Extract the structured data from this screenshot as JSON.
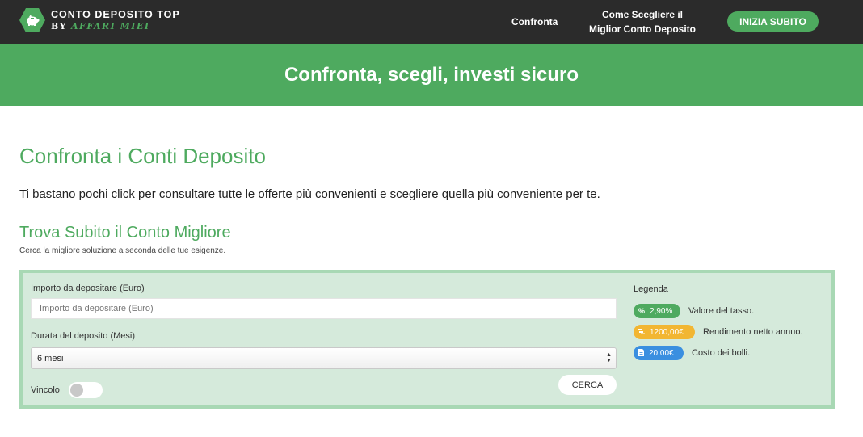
{
  "header": {
    "logo_title": "CONTO DEPOSITO TOP",
    "logo_by": "BY",
    "logo_brand": "AFFARI MIEI",
    "nav": {
      "confronta": "Confronta",
      "come_line1": "Come Scegliere il",
      "come_line2": "Miglior Conto Deposito"
    },
    "cta_label": "INIZIA SUBITO"
  },
  "banner": {
    "title": "Confronta, scegli, investi sicuro"
  },
  "main": {
    "title": "Confronta i Conti Deposito",
    "intro": "Ti bastano pochi click per consultare tutte le offerte più convenienti e scegliere quella più conveniente per te.",
    "section_title": "Trova Subito il Conto Migliore",
    "section_sub": "Cerca la migliore soluzione a seconda delle tue esigenze."
  },
  "form": {
    "amount_label": "Importo da depositare (Euro)",
    "amount_placeholder": "Importo da depositare (Euro)",
    "duration_label": "Durata del deposito (Mesi)",
    "duration_selected": "6 mesi",
    "vincolo_label": "Vincolo",
    "vincolo_on": false,
    "search_button": "CERCA"
  },
  "legend": {
    "title": "Legenda",
    "items": [
      {
        "icon": "percent-icon",
        "badge": "2,90%",
        "desc": "Valore del tasso.",
        "color": "#4eaa5f"
      },
      {
        "icon": "coins-icon",
        "badge": "1200,00€",
        "desc": "Rendimento netto annuo.",
        "color": "#f2b632"
      },
      {
        "icon": "document-icon",
        "badge": "20,00€",
        "desc": "Costo dei bolli.",
        "color": "#3a8fe0"
      }
    ]
  },
  "colors": {
    "brand_green": "#4eaa5f",
    "topbar": "#2b2b2b",
    "panel_bg": "#d5eadb",
    "panel_border": "#a8d8b4"
  }
}
